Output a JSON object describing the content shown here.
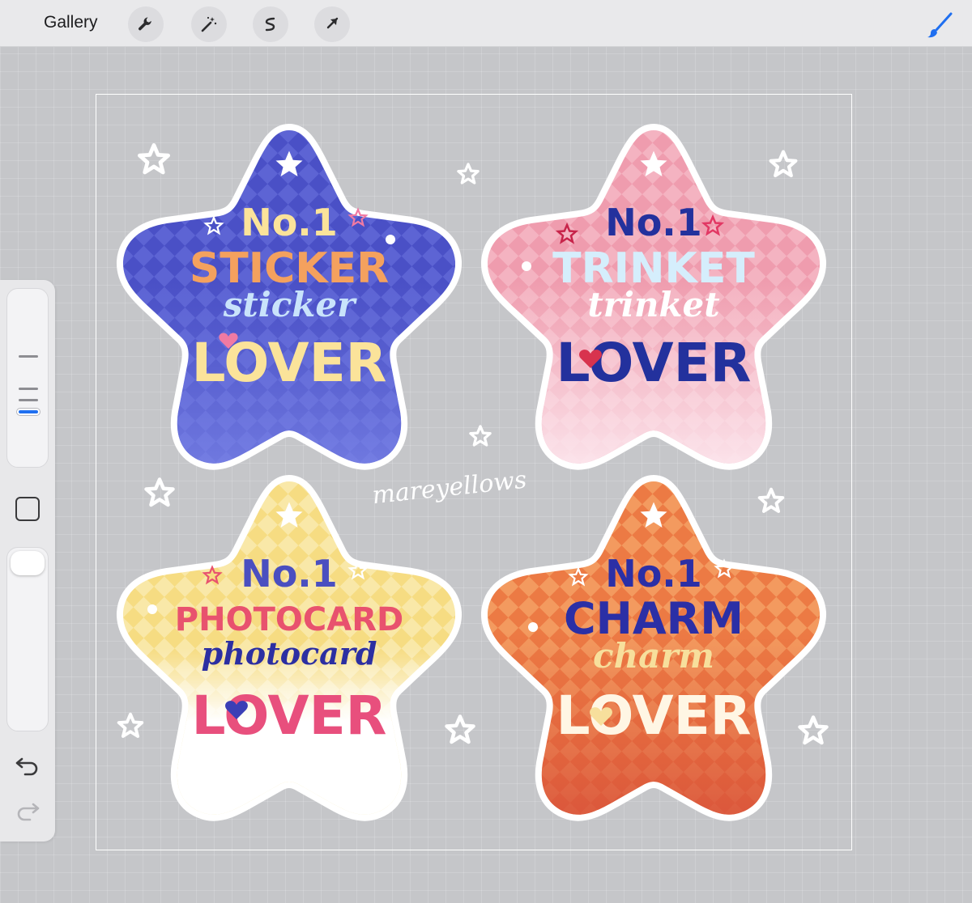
{
  "toolbar": {
    "gallery_label": "Gallery",
    "tools": [
      "wrench-icon",
      "magic-wand-icon",
      "selection-icon",
      "move-arrow-icon"
    ],
    "active_tool": "brush-icon",
    "accent_color": "#1f6ff0"
  },
  "sidebar": {
    "controls": [
      "brush-size-slider",
      "modify-button",
      "opacity-slider",
      "undo-icon",
      "redo-icon"
    ]
  },
  "artwork": {
    "signature": "mareyellows",
    "stickers": [
      {
        "number": "No.1",
        "word": "STICKER",
        "script": "sticker",
        "tail": "LOVER",
        "palette": [
          "#4c52c8",
          "#f4a15e",
          "#c9e3fb",
          "#fbe39a"
        ]
      },
      {
        "number": "No.1",
        "word": "TRINKET",
        "script": "trinket",
        "tail": "LOVER",
        "palette": [
          "#f1a2b3",
          "#23319d",
          "#d5eefc",
          "#ffffff"
        ]
      },
      {
        "number": "No.1",
        "word": "PHOTOCARD",
        "script": "photocard",
        "tail": "LOVER",
        "palette": [
          "#f7e189",
          "#e8526e",
          "#2c2fa2",
          "#e84f7d"
        ]
      },
      {
        "number": "No.1",
        "word": "CHARM",
        "script": "charm",
        "tail": "LOVER",
        "palette": [
          "#ee7b44",
          "#2b2fa6",
          "#f7df9c",
          "#fff6e4"
        ]
      }
    ]
  }
}
